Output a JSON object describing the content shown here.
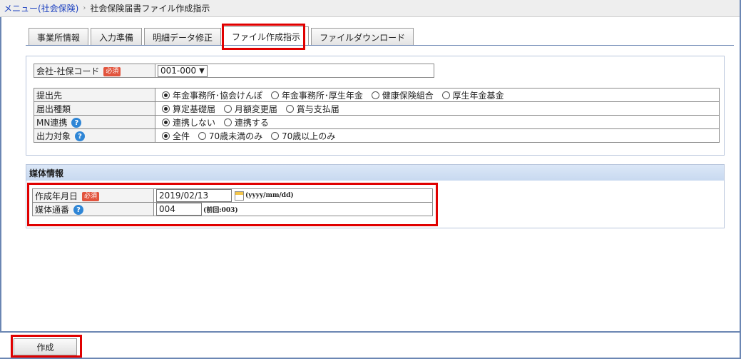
{
  "breadcrumb": {
    "menu_link": "メニュー(社会保険)",
    "separator": "›",
    "current": "社会保険届書ファイル作成指示"
  },
  "tabs": [
    {
      "label": "事業所情報"
    },
    {
      "label": "入力準備"
    },
    {
      "label": "明細データ修正"
    },
    {
      "label": "ファイル作成指示",
      "active": true
    },
    {
      "label": "ファイルダウンロード"
    }
  ],
  "company": {
    "label": "会社-社保コード",
    "required": "必須",
    "value": "001-000"
  },
  "submit_to": {
    "label": "提出先",
    "options": [
      "年金事務所･協会けんぽ",
      "年金事務所･厚生年金",
      "健康保険組合",
      "厚生年金基金"
    ],
    "selected": 0
  },
  "report_type": {
    "label": "届出種類",
    "options": [
      "算定基礎届",
      "月額変更届",
      "賞与支払届"
    ],
    "selected": 0
  },
  "mn_link": {
    "label": "MN連携",
    "options": [
      "連携しない",
      "連携する"
    ],
    "selected": 0
  },
  "output_target": {
    "label": "出力対象",
    "options": [
      "全件",
      "70歳未満のみ",
      "70歳以上のみ"
    ],
    "selected": 0
  },
  "media": {
    "header": "媒体情報",
    "date_label": "作成年月日",
    "date_required": "必須",
    "date_value": "2019/02/13",
    "date_hint": "(yyyy/mm/dd)",
    "serial_label": "媒体通番",
    "serial_value": "004",
    "serial_hint": "(前回:003)"
  },
  "footer": {
    "create_label": "作成"
  },
  "colors": {
    "highlight": "#e00000",
    "required_badge": "#e2543d",
    "help_icon": "#2f86d6",
    "link": "#1a3fbf"
  },
  "icons": {
    "help": "?",
    "dropdown": "chevron-down-icon",
    "calendar": "calendar-icon"
  }
}
